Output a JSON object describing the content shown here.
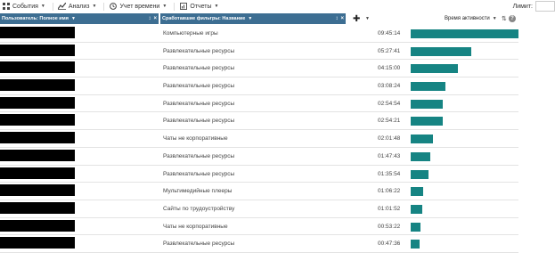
{
  "toolbar": {
    "items": [
      {
        "label": "События",
        "icon": "grid-icon"
      },
      {
        "label": "Анализ",
        "icon": "chart-line-icon"
      },
      {
        "label": "Учет времени",
        "icon": "clock-icon"
      },
      {
        "label": "Отчеты",
        "icon": "report-icon"
      }
    ],
    "limit_label": "Лимит:",
    "limit_value": ""
  },
  "table": {
    "headers": {
      "user": "Пользователь: Полное имя",
      "filter": "Сработавшие фильтры: Название",
      "time": "Время активности"
    },
    "max_seconds": 35000,
    "bar_color": "#168483",
    "header_color": "#3d6e92",
    "rows": [
      {
        "filter": "Компьютерные игры",
        "time": "09:45:14",
        "seconds": 35114
      },
      {
        "filter": "Развлекательные ресурсы",
        "time": "05:27:41",
        "seconds": 19661
      },
      {
        "filter": "Развлекательные ресурсы",
        "time": "04:15:00",
        "seconds": 15300
      },
      {
        "filter": "Развлекательные ресурсы",
        "time": "03:08:24",
        "seconds": 11304
      },
      {
        "filter": "Развлекательные ресурсы",
        "time": "02:54:54",
        "seconds": 10494
      },
      {
        "filter": "Развлекательные ресурсы",
        "time": "02:54:21",
        "seconds": 10461
      },
      {
        "filter": "Чаты не корпоративные",
        "time": "02:01:48",
        "seconds": 7308
      },
      {
        "filter": "Развлекательные ресурсы",
        "time": "01:47:43",
        "seconds": 6463
      },
      {
        "filter": "Развлекательные ресурсы",
        "time": "01:35:54",
        "seconds": 5754
      },
      {
        "filter": "Мультимедийные плееры",
        "time": "01:06:22",
        "seconds": 3982
      },
      {
        "filter": "Сайты по трудоустройству",
        "time": "01:01:52",
        "seconds": 3712
      },
      {
        "filter": "Чаты не корпоративные",
        "time": "00:53:22",
        "seconds": 3202
      },
      {
        "filter": "Развлекательные ресурсы",
        "time": "00:47:36",
        "seconds": 2856
      }
    ]
  }
}
